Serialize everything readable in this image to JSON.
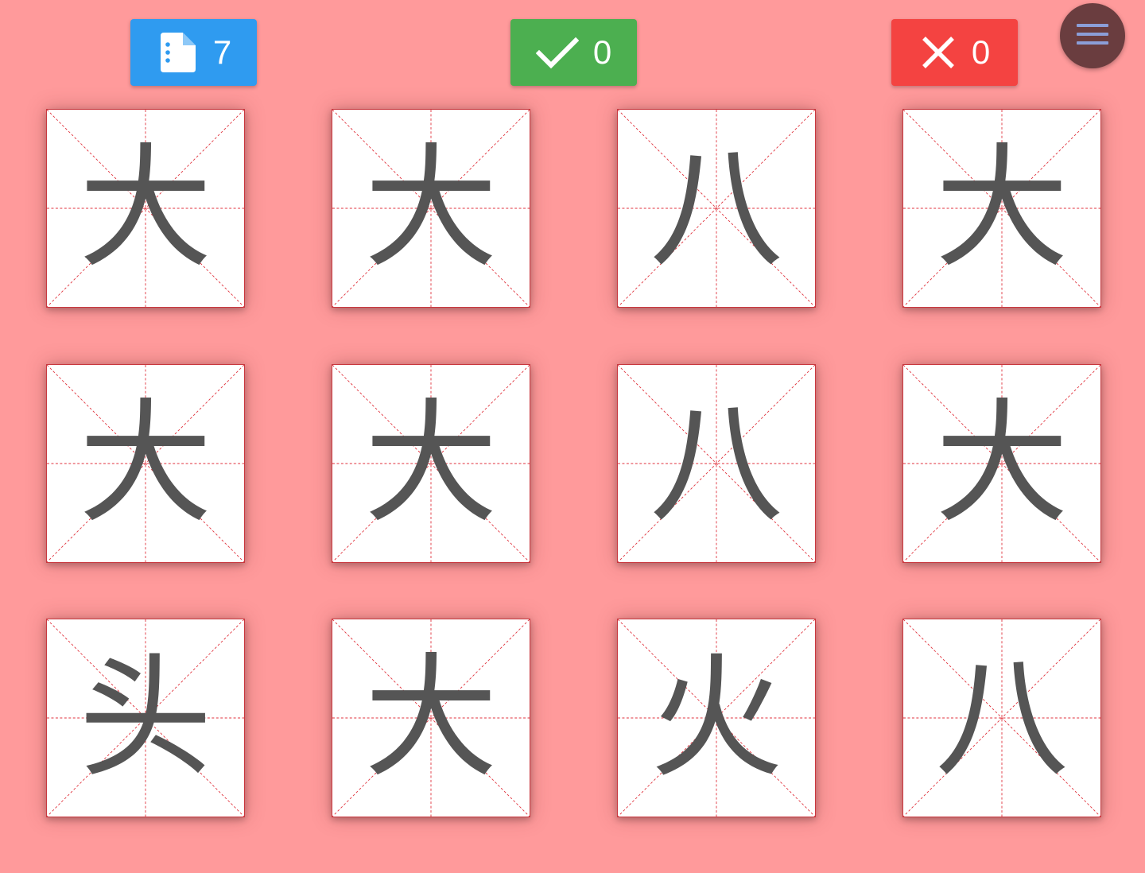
{
  "header": {
    "total": {
      "count": "7",
      "icon": "document-list-icon",
      "color": "#2f9bf0"
    },
    "correct": {
      "count": "0",
      "icon": "check-icon",
      "color": "#4caf50"
    },
    "wrong": {
      "count": "0",
      "icon": "close-icon",
      "color": "#f44341"
    },
    "menu": {
      "icon": "hamburger-menu-icon",
      "color": "#6a3d3f",
      "icon_color": "#8b9ed8"
    }
  },
  "grid": {
    "line_color": "#e0323c",
    "cards": [
      {
        "character": "大"
      },
      {
        "character": "大"
      },
      {
        "character": "八"
      },
      {
        "character": "大"
      },
      {
        "character": "大"
      },
      {
        "character": "大"
      },
      {
        "character": "八"
      },
      {
        "character": "大"
      },
      {
        "character": "头"
      },
      {
        "character": "大"
      },
      {
        "character": "火"
      },
      {
        "character": "八"
      }
    ]
  }
}
